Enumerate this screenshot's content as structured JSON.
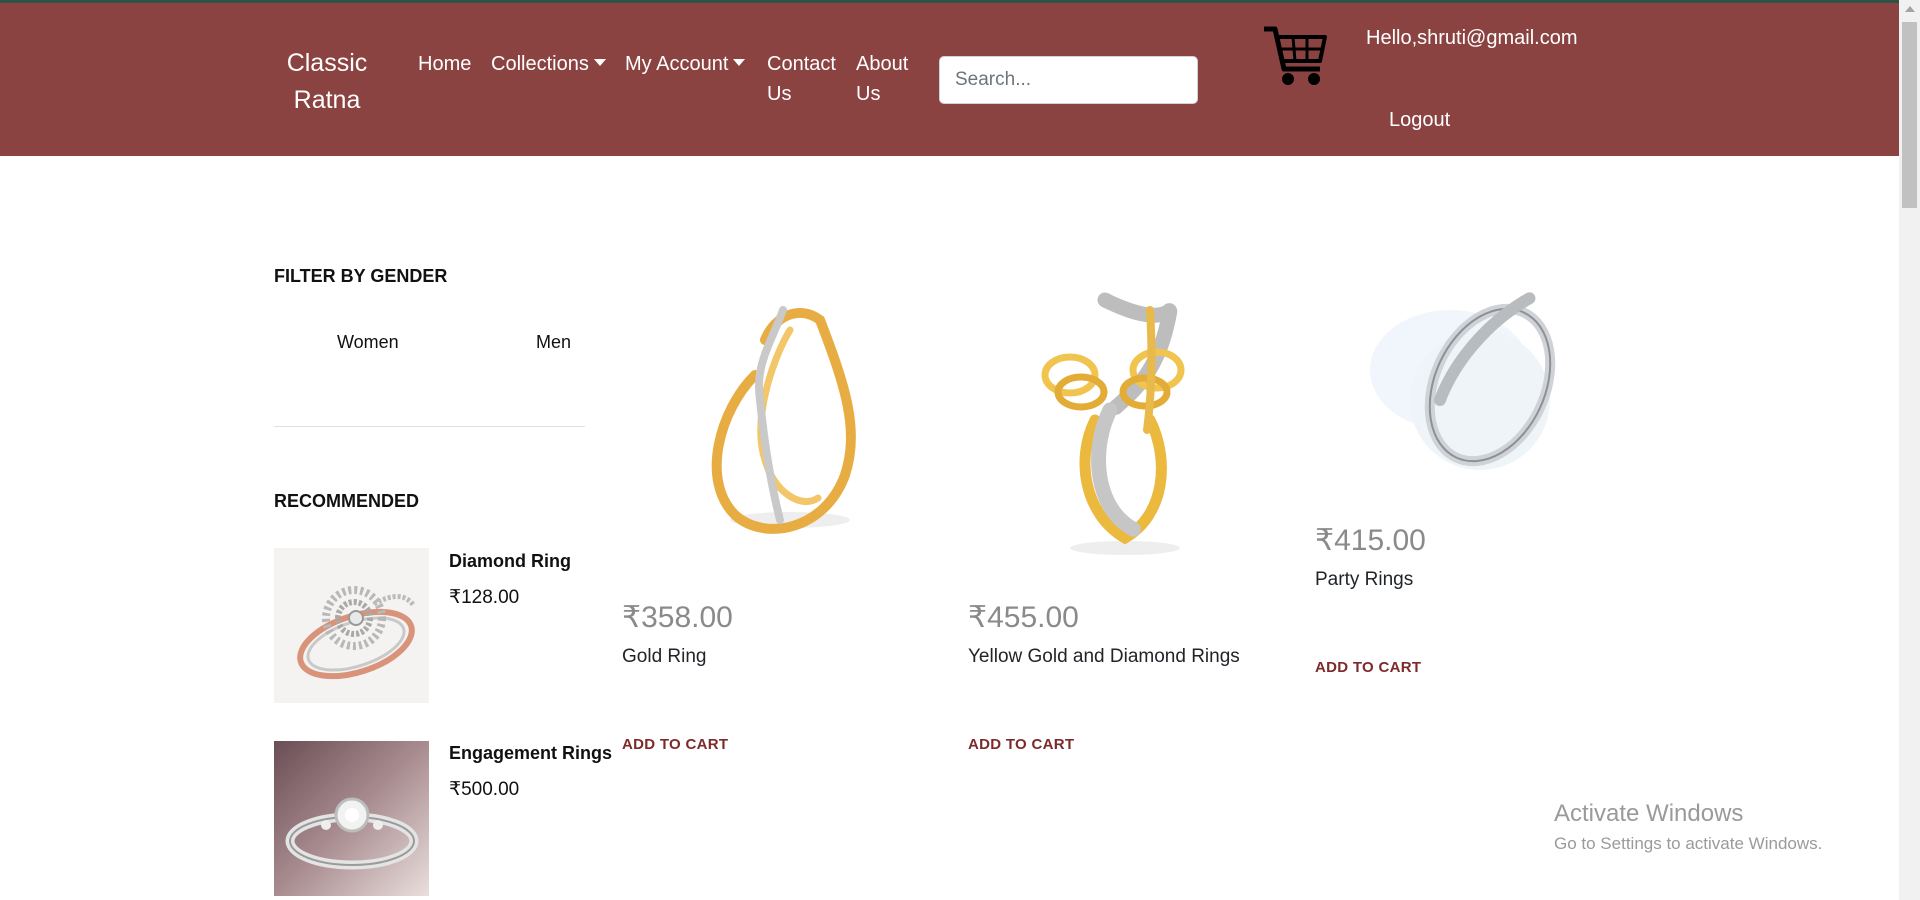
{
  "brand": "Classic Ratna",
  "nav": {
    "home": "Home",
    "collections": "Collections",
    "my_account": "My Account",
    "contact": "Contact Us",
    "about": "About Us"
  },
  "search": {
    "placeholder": "Search..."
  },
  "user": {
    "greeting": "Hello,shruti@gmail.com",
    "logout": "Logout"
  },
  "sidebar": {
    "filter_title": "FILTER BY GENDER",
    "genders": [
      "Women",
      "Men"
    ],
    "recommended_title": "RECOMMENDED",
    "recommended": [
      {
        "name": "Diamond Ring",
        "price": "₹128.00"
      },
      {
        "name": "Engagement Rings",
        "price": "₹500.00"
      }
    ]
  },
  "products": [
    {
      "price": "₹358.00",
      "name": "Gold Ring",
      "cta": "ADD TO CART"
    },
    {
      "price": "₹455.00",
      "name": "Yellow Gold and Diamond Rings",
      "cta": "ADD TO CART"
    },
    {
      "price": "₹415.00",
      "name": "Party Rings",
      "cta": "ADD TO CART"
    }
  ],
  "watermark": {
    "title": "Activate Windows",
    "subtitle": "Go to Settings to activate Windows."
  },
  "colors": {
    "navbar": "#8b4342",
    "accent": "#7b2b2a",
    "price": "#8a8a8a"
  }
}
